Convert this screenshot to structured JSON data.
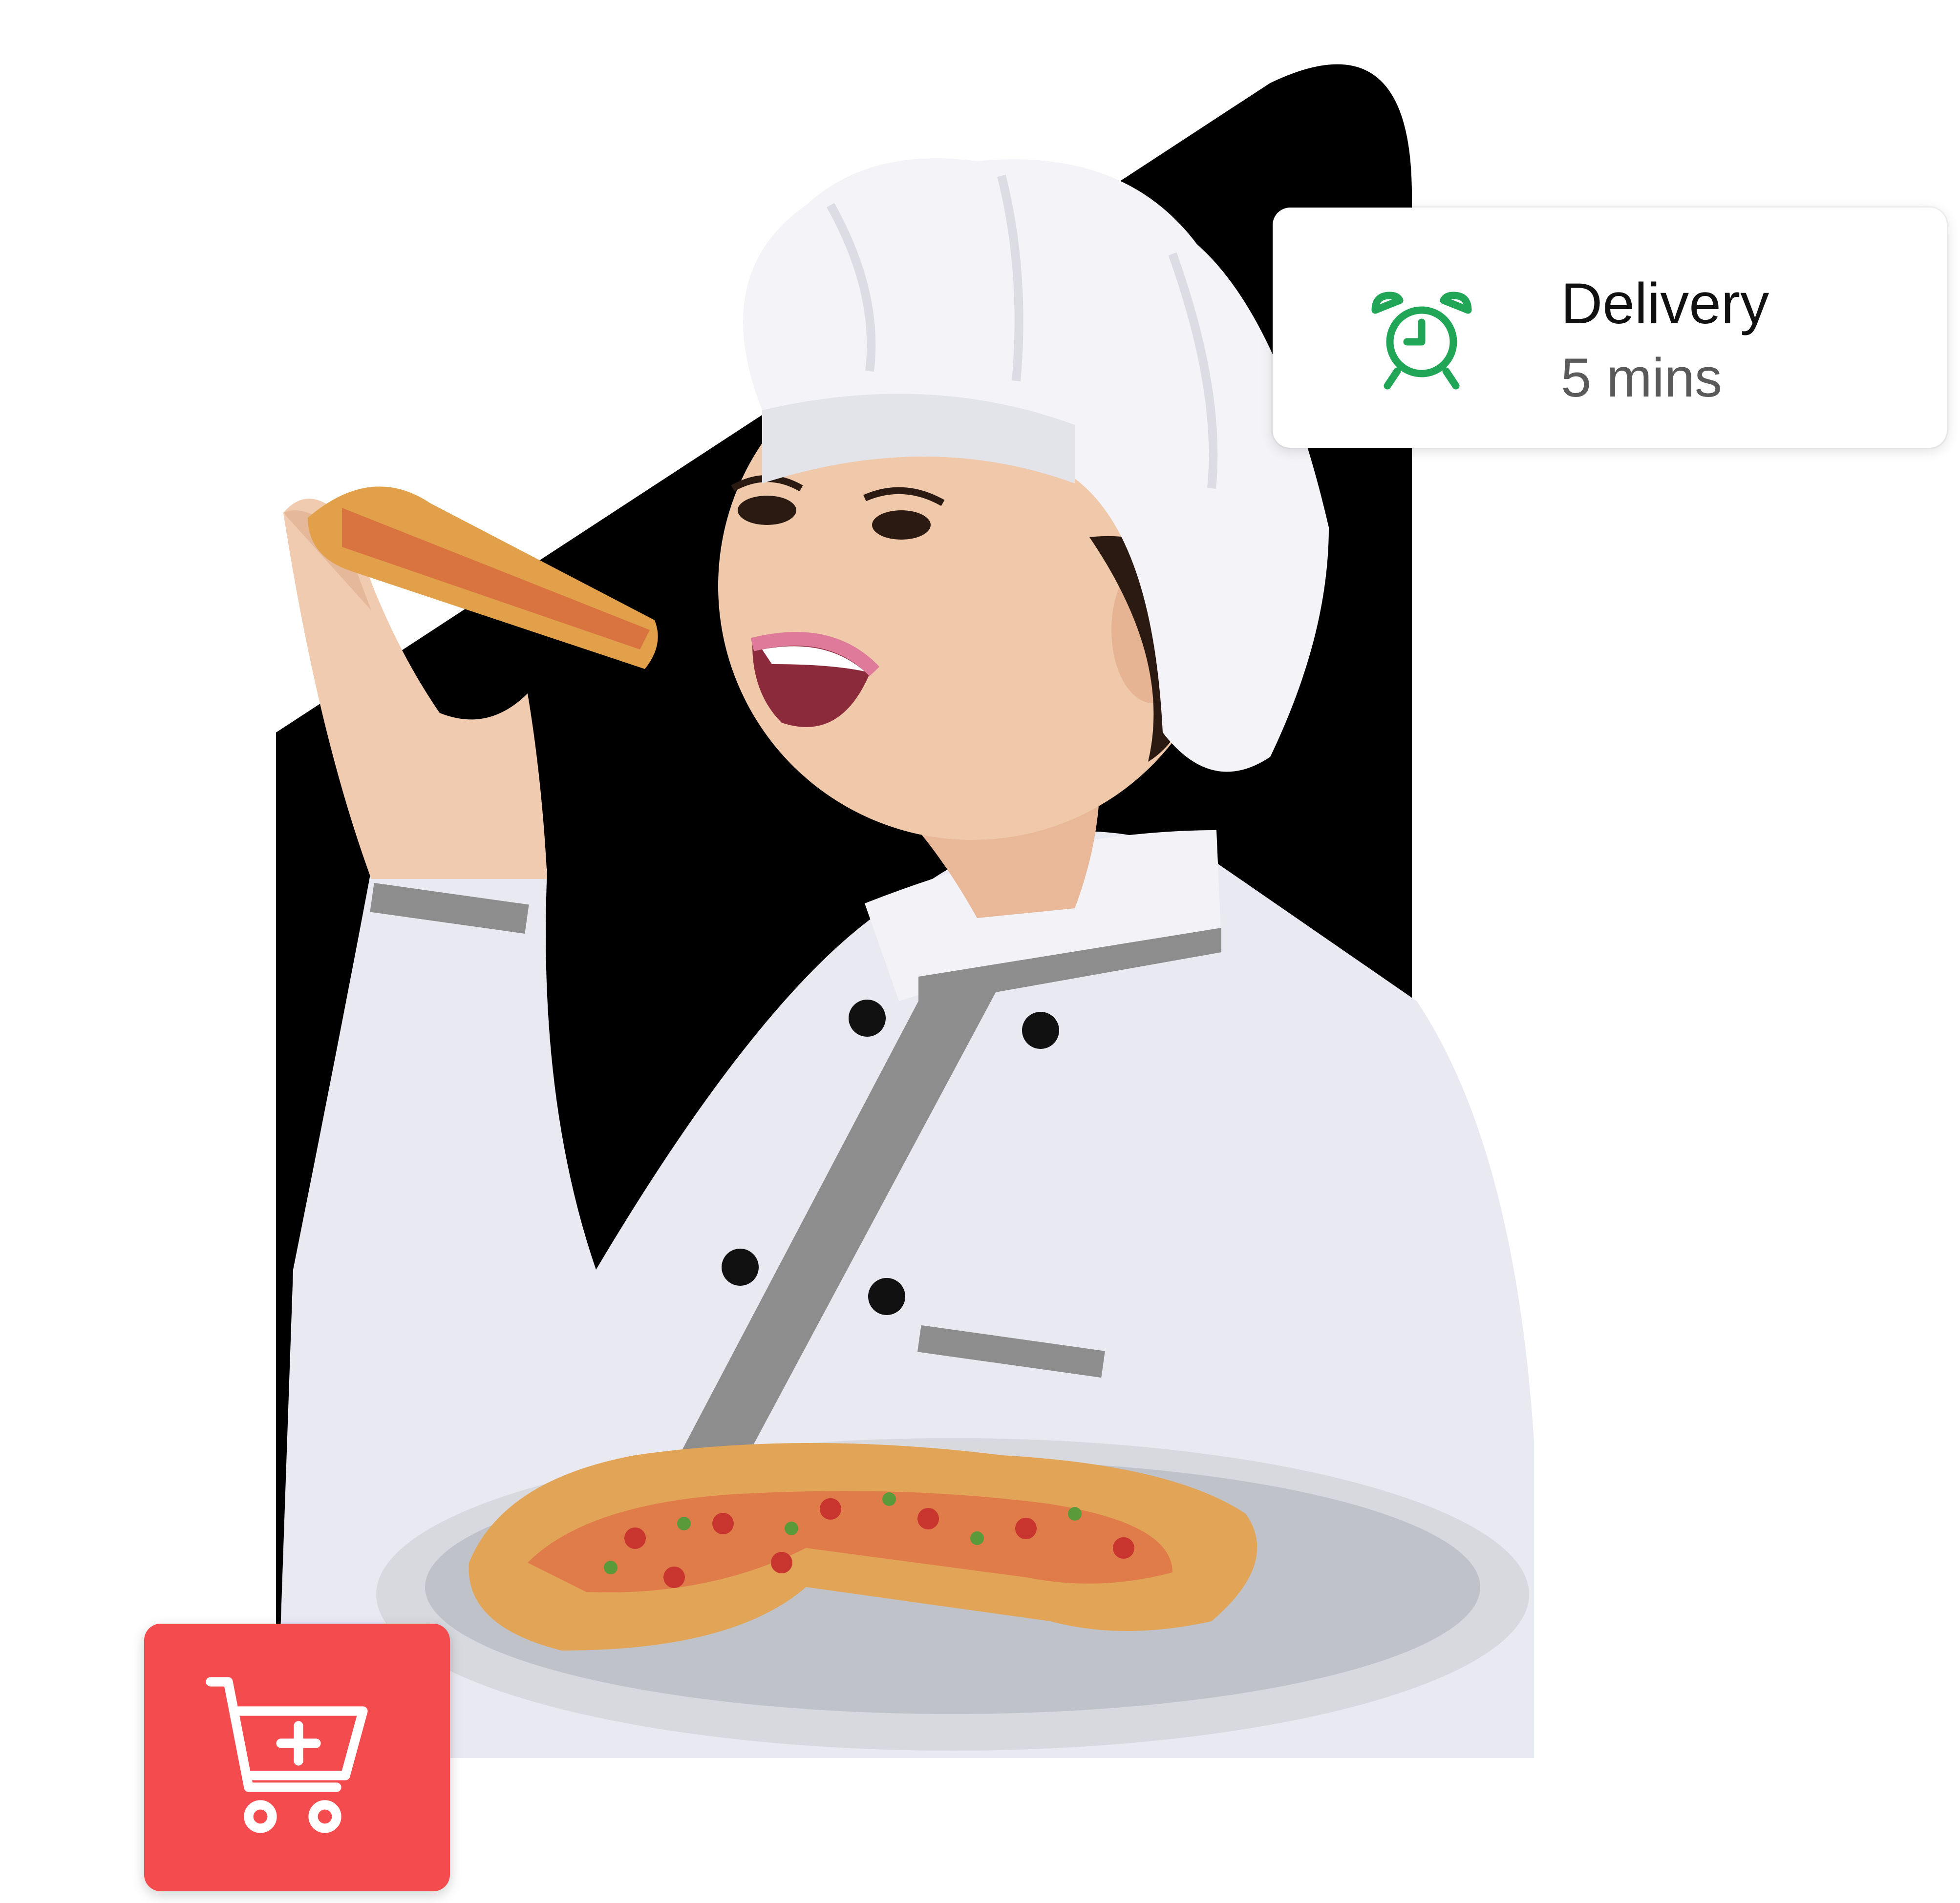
{
  "delivery": {
    "title": "Delivery",
    "value": "5 mins",
    "icon": "alarm-clock-icon",
    "icon_color": "#21a557"
  },
  "cart": {
    "icon": "add-to-cart-icon",
    "background_color": "#f34b4e"
  },
  "hero": {
    "backdrop_color": "#000000"
  }
}
